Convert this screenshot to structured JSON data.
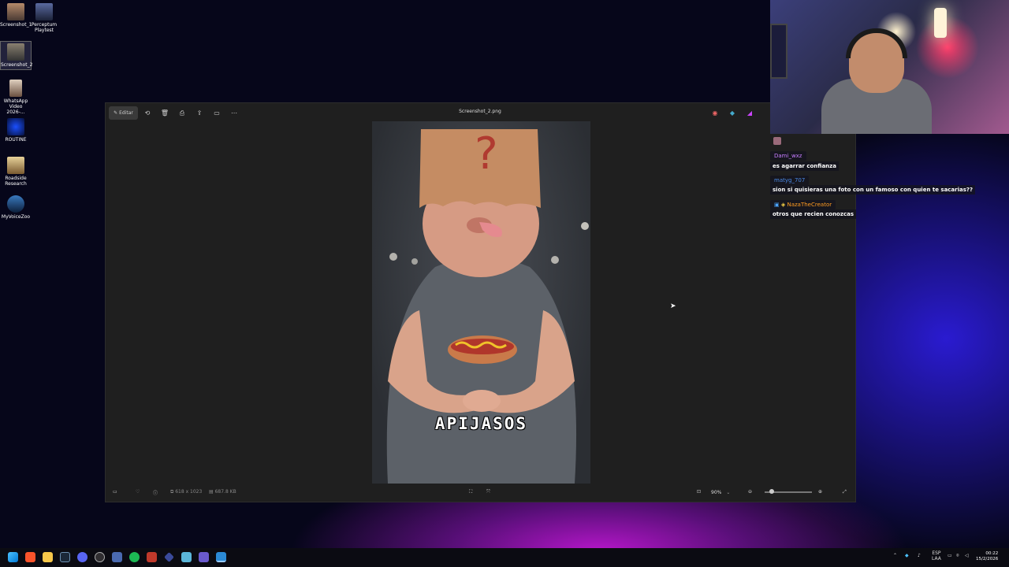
{
  "desktop": {
    "icons": [
      {
        "label": "Screenshot_1"
      },
      {
        "label": "Perceptum Playtest"
      },
      {
        "label": "Screenshot_2"
      },
      {
        "label": "WhatsApp Video 2026-..."
      },
      {
        "label": "ROUTINE"
      },
      {
        "label": "Roadside Research"
      },
      {
        "label": "MyVoiceZoo"
      }
    ]
  },
  "viewer": {
    "title": "Screenshot_2.png",
    "edit_label": "Editar",
    "caption": "APIJASOS",
    "dimensions": "618 x 1023",
    "file_size": "687.8 KB",
    "zoom": "90%"
  },
  "chat": {
    "messages": [
      {
        "user": "Dami_wxz",
        "text": "es agarrar confianza",
        "color": "#c77dff"
      },
      {
        "user": "matyg_707",
        "text": "sion si quisieras una foto con un famoso con quien te sacarias??",
        "color": "#3a7bd5"
      },
      {
        "user": "NazaTheCreator",
        "text": "otros que recien conozcas",
        "color": "#ff9b21"
      }
    ]
  },
  "taskbar": {
    "lang_top": "ESP",
    "lang_bottom": "LAA",
    "time": "00:22",
    "date": "15/2/2026"
  }
}
